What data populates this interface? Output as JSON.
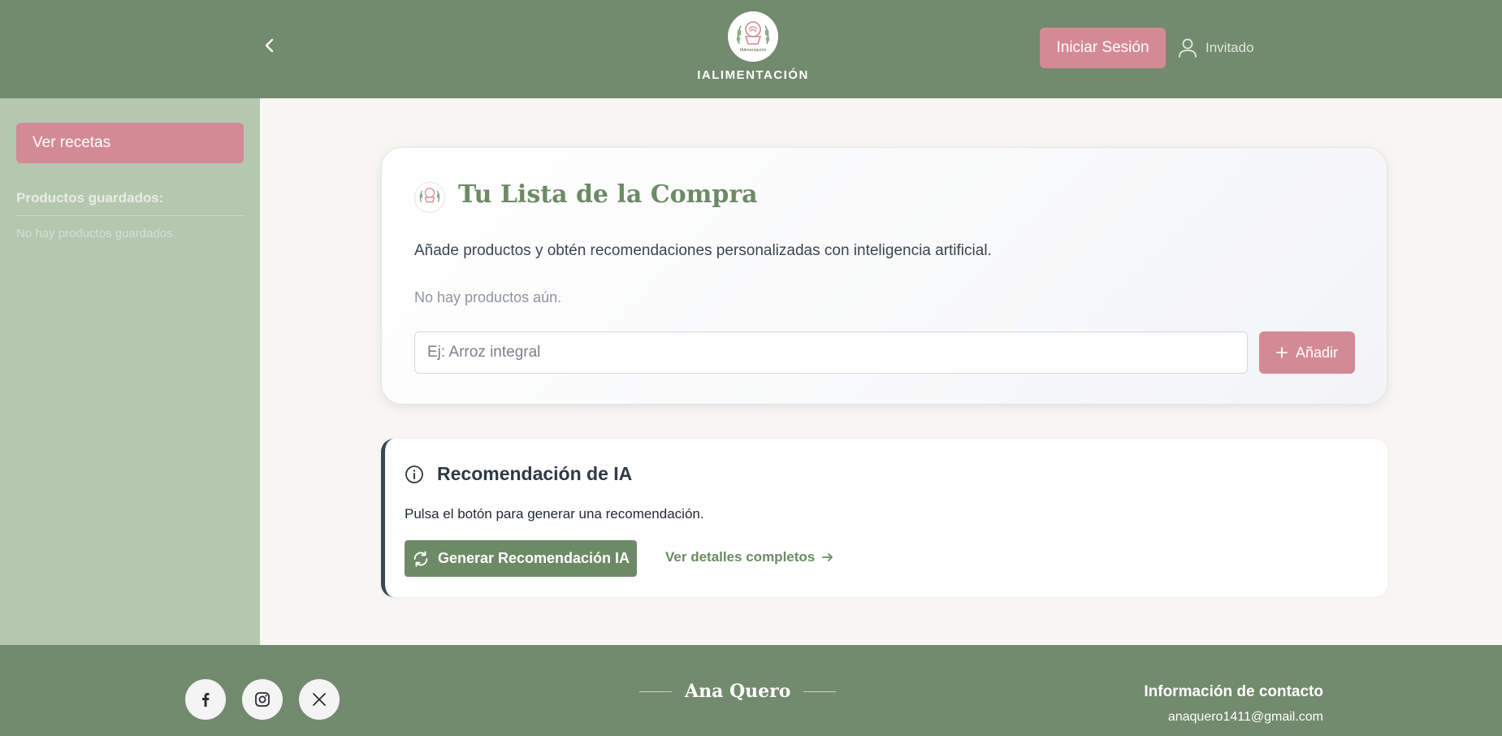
{
  "header": {
    "brand_name": "IALIMENTACIÓN",
    "logo_text": "IAlimentación",
    "login_label": "Iniciar Sesión",
    "user_label": "Invitado",
    "icons": {
      "back": "chevron-left-icon",
      "user": "user-icon"
    }
  },
  "sidebar": {
    "recipes_button": "Ver recetas",
    "saved_title": "Productos guardados:",
    "saved_empty": "No hay productos guardados."
  },
  "shopping_list": {
    "title": "Tu Lista de la Compra",
    "description": "Añade productos y obtén recomendaciones personalizadas con inteligencia artificial.",
    "empty_message": "No hay productos aún.",
    "input": {
      "value": "",
      "placeholder": "Ej: Arroz integral"
    },
    "add_label": "Añadir"
  },
  "recommendation": {
    "title": "Recomendación de IA",
    "text": "Pulsa el botón para generar una recomendación.",
    "generate_label": "Generar Recomendación IA",
    "details_label": "Ver detalles completos"
  },
  "footer": {
    "social": [
      "facebook-icon",
      "instagram-icon",
      "x-icon"
    ],
    "name": "Ana Quero",
    "contact_title": "Información de contacto",
    "contact_email": "anaquero1411@gmail.com"
  },
  "colors": {
    "header_green": "#728a6d",
    "sidebar_green": "#b4c8b0",
    "accent_pink": "#d48a94",
    "primary_green": "#6d8a66",
    "background": "#f8f6f2"
  }
}
